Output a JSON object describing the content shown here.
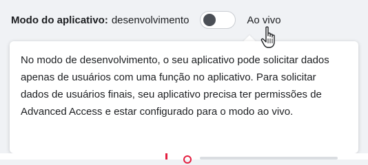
{
  "mode_row": {
    "label": "Modo do aplicativo:",
    "current_mode": "desenvolvimento",
    "toggle_on": false,
    "live_label": "Ao vivo"
  },
  "tooltip": {
    "text": "No modo de desenvolvimento, o seu aplicativo pode solicitar dados apenas de usuários com uma função no aplicativo. Para solicitar dados de usuários finais, seu aplicativo precisa ter permissões de Advanced Access e estar configurado para o modo ao vivo."
  },
  "icons": {
    "cursor": "hand-pointer-icon",
    "warning": "alert-circle-icon"
  },
  "colors": {
    "toggle_knob": "#4b4f56",
    "alert_red": "#e41e3f"
  }
}
